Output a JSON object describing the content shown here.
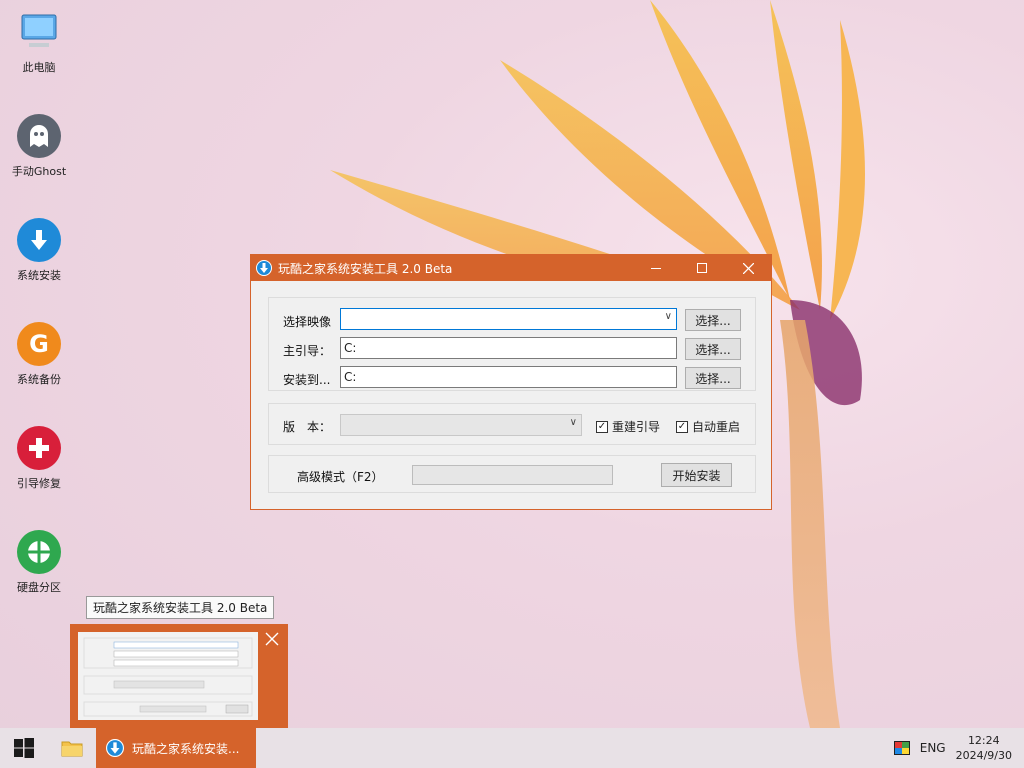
{
  "desktop": {
    "icons": [
      {
        "label": "此电脑",
        "icon": "computer-icon",
        "color": "#5aa7e6"
      },
      {
        "label": "手动Ghost",
        "icon": "ghost-icon",
        "color": "#5d6470"
      },
      {
        "label": "系统安装",
        "icon": "download-icon",
        "color": "#1f8ad8"
      },
      {
        "label": "系统备份",
        "icon": "backup-icon",
        "color": "#f08a1c"
      },
      {
        "label": "引导修复",
        "icon": "plus-icon",
        "color": "#d81f3a"
      },
      {
        "label": "硬盘分区",
        "icon": "partition-icon",
        "color": "#2fa84f"
      }
    ]
  },
  "window": {
    "title": "玩酷之家系统安装工具 2.0 Beta",
    "accent": "#d5632b",
    "image_label": "选择映像",
    "image_value": "",
    "boot_label": "主引导：",
    "boot_value": "C:",
    "install_label": "安装到...",
    "install_value": "C:",
    "browse_label": "选择...",
    "version_label": "版　本：",
    "version_value": "",
    "rebuild_boot_label": "重建引导",
    "rebuild_boot_checked": true,
    "auto_restart_label": "自动重启",
    "auto_restart_checked": true,
    "advanced_label": "高级模式（F2）",
    "progress": 0,
    "start_label": "开始安装"
  },
  "tooltip": "玩酷之家系统安装工具 2.0 Beta",
  "taskbar": {
    "app_label": "玩酷之家系统安装...",
    "lang": "ENG",
    "time": "12:24",
    "date": "2024/9/30"
  }
}
